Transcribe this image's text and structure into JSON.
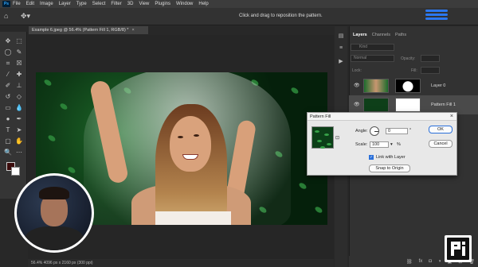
{
  "menubar": {
    "app_logo": "Ps",
    "items": [
      "File",
      "Edit",
      "Image",
      "Layer",
      "Type",
      "Select",
      "Filter",
      "3D",
      "View",
      "Plugins",
      "Window",
      "Help"
    ]
  },
  "options": {
    "hint": "Click and drag to reposition the pattern."
  },
  "document": {
    "tab_title": "Example 6.jpeg @ 56.4% (Pattern Fill 1, RGB/8) *",
    "status": "56.4%   4096 px x 2160 px (300 ppi)"
  },
  "panel": {
    "tabs": [
      "Layers",
      "Channels",
      "Paths"
    ],
    "kind_label": "Kind",
    "blend_mode": "Normal",
    "opacity_label": "Opacity:",
    "lock_label": "Lock:",
    "fill_label": "Fill:",
    "layers": [
      {
        "name": "Layer 0",
        "selected": false
      },
      {
        "name": "Pattern Fill 1",
        "selected": true
      }
    ],
    "bottom_icons": [
      "link-icon",
      "fx-icon",
      "mask-icon",
      "adjustment-icon",
      "group-icon",
      "new-layer-icon",
      "trash-icon"
    ],
    "bottom_glyphs": [
      "⛓",
      "fx",
      "◘",
      "◑",
      "▣",
      "⊞",
      "🗑"
    ]
  },
  "dialog": {
    "title": "Pattern Fill",
    "angle_label": "Angle:",
    "angle_value": "0",
    "scale_label": "Scale:",
    "scale_value": "100",
    "scale_unit": "%",
    "link_label": "Link with Layer",
    "link_checked": true,
    "snap_label": "Snap to Origin",
    "ok_label": "OK",
    "cancel_label": "Cancel"
  },
  "colors": {
    "accent": "#2b78f0",
    "foreground_swatch": "#3b0c0c",
    "background_swatch": "#ffffff"
  }
}
